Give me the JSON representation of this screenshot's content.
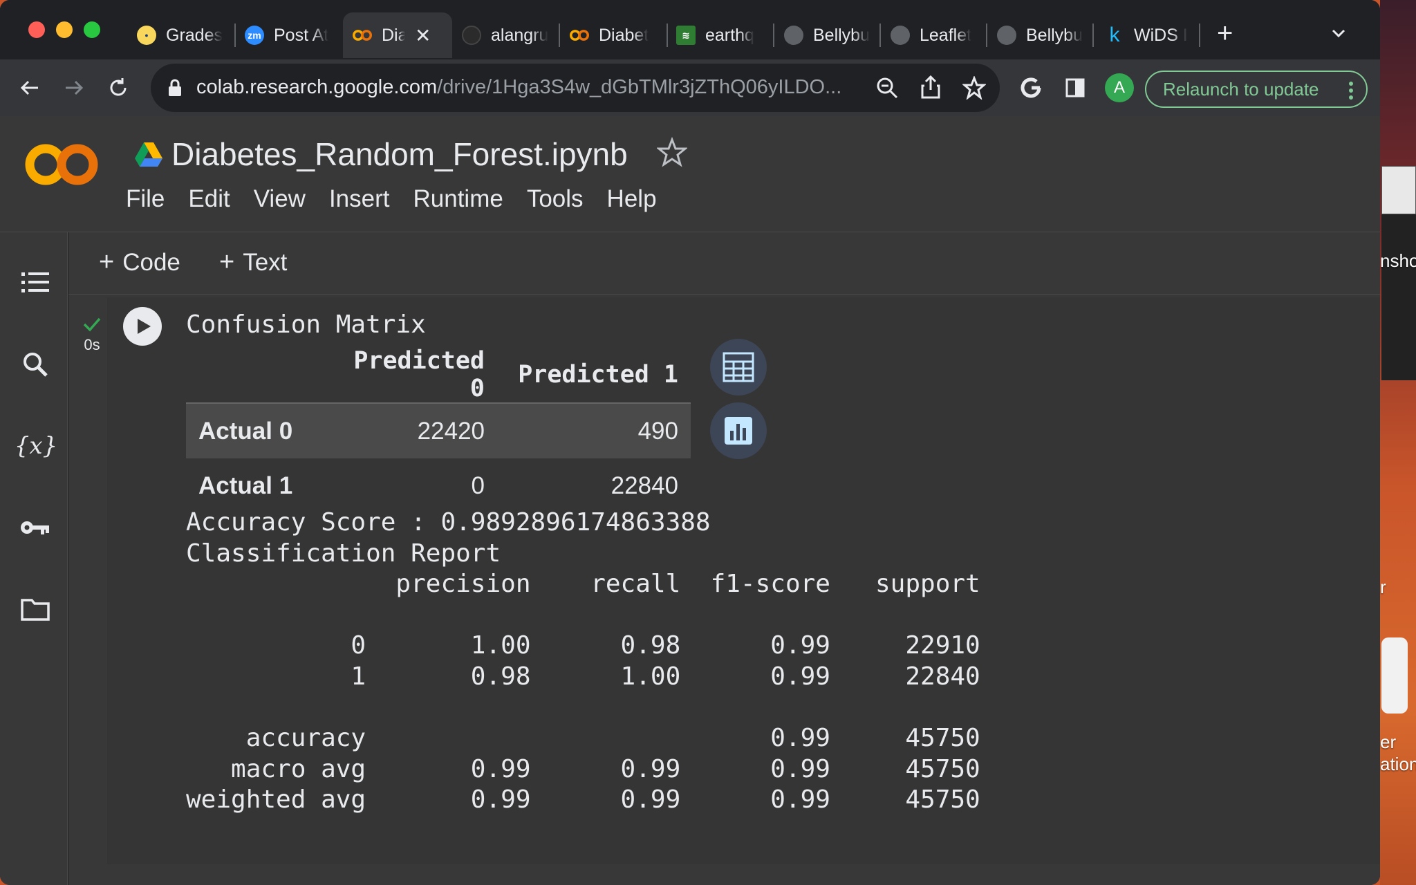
{
  "browser": {
    "tabs": [
      {
        "label": "Grades",
        "favicon": "school-icon"
      },
      {
        "label": "Post At",
        "favicon": "zoom-icon"
      },
      {
        "label": "Dia",
        "favicon": "colab-icon",
        "active": true
      },
      {
        "label": "alangru",
        "favicon": "github-icon"
      },
      {
        "label": "Diabet",
        "favicon": "colab-icon"
      },
      {
        "label": "earthq",
        "favicon": "chart-icon"
      },
      {
        "label": "Bellybu",
        "favicon": "globe-icon"
      },
      {
        "label": "Leaflet",
        "favicon": "globe-icon"
      },
      {
        "label": "Bellybu",
        "favicon": "globe-icon"
      },
      {
        "label": "WiDS I",
        "favicon": "kaggle-icon"
      }
    ],
    "url_host": "colab.research.google.com",
    "url_path": "/drive/1Hga3S4w_dGbTMlr3jZThQ06yILDO...",
    "relaunch_label": "Relaunch to update",
    "profile_initial": "A"
  },
  "notebook": {
    "title": "Diabetes_Random_Forest.ipynb",
    "menu": [
      "File",
      "Edit",
      "View",
      "Insert",
      "Runtime",
      "Tools",
      "Help"
    ],
    "add_code": "Code",
    "add_text": "Text"
  },
  "cell": {
    "exec_time": "0s",
    "cm_title": "Confusion Matrix",
    "table": {
      "columns": [
        "",
        "Predicted 0",
        "Predicted 1"
      ],
      "rows": [
        {
          "label": "Actual 0",
          "values": [
            "22420",
            "490"
          ]
        },
        {
          "label": "Actual 1",
          "values": [
            "0",
            "22840"
          ]
        }
      ]
    },
    "accuracy_line": "Accuracy Score : 0.9892896174863388",
    "report_title": "Classification Report",
    "report_header": "              precision    recall  f1-score   support",
    "report_rows": [
      "",
      "           0       1.00      0.98      0.99     22910",
      "           1       0.98      1.00      0.99     22840",
      "",
      "    accuracy                           0.99     45750",
      "   macro avg       0.99      0.99      0.99     45750",
      "weighted avg       0.99      0.99      0.99     45750"
    ]
  },
  "desktop": {
    "side_text": [
      "nsho",
      "r",
      "er",
      "ation"
    ]
  },
  "colors": {
    "success": "#34a853",
    "accent_orange": "#f9ab00",
    "relaunch_green": "#81c995"
  }
}
